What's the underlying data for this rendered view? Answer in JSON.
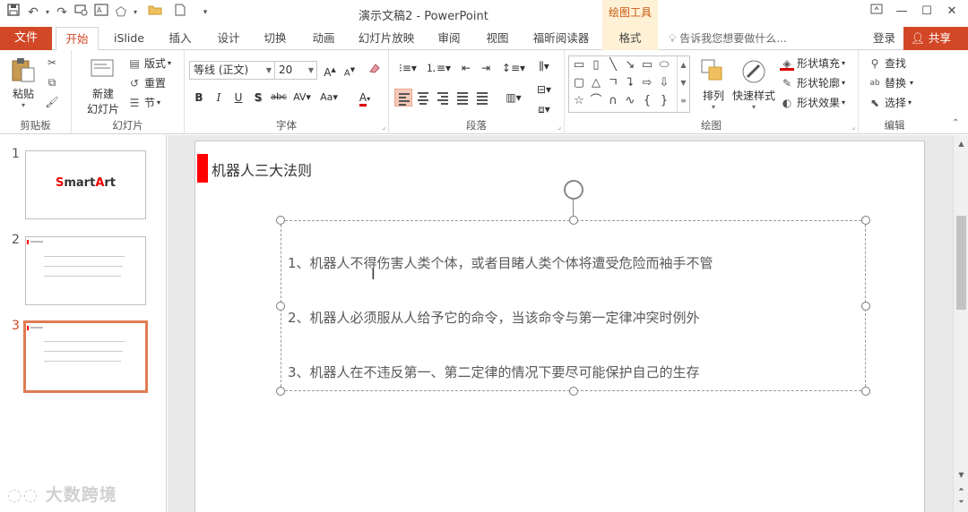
{
  "window": {
    "title": "演示文稿2 - PowerPoint",
    "context_tab": "绘图工具"
  },
  "tabs": {
    "file": "文件",
    "items": [
      "开始",
      "iSlide",
      "插入",
      "设计",
      "切换",
      "动画",
      "幻灯片放映",
      "审阅",
      "视图",
      "福昕阅读器",
      "格式"
    ],
    "active": "开始",
    "tell_me": "告诉我您想要做什么...",
    "login": "登录",
    "share": "共享"
  },
  "ribbon": {
    "clipboard": {
      "label": "剪贴板",
      "paste": "粘贴"
    },
    "slides": {
      "label": "幻灯片",
      "new_slide_line1": "新建",
      "new_slide_line2": "幻灯片",
      "layout": "版式",
      "reset": "重置",
      "section": "节"
    },
    "font": {
      "label": "字体",
      "font_name": "等线 (正文)",
      "font_size": "20"
    },
    "paragraph": {
      "label": "段落"
    },
    "drawing": {
      "label": "绘图",
      "arrange": "排列",
      "quick_styles": "快速样式",
      "shape_fill": "形状填充",
      "shape_outline": "形状轮廓",
      "shape_effects": "形状效果"
    },
    "editing": {
      "label": "编辑",
      "find": "查找",
      "replace": "替换",
      "select": "选择"
    }
  },
  "thumbnails": {
    "numbers": [
      "1",
      "2",
      "3"
    ],
    "slide1_text": "SmartArt",
    "active_index": 3
  },
  "slide": {
    "title": "机器人三大法则",
    "paragraphs": [
      "1、机器人不得伤害人类个体，或者目睹人类个体将遭受危险而袖手不管",
      "2、机器人必须服从人给予它的命令，当该命令与第一定律冲突时例外",
      "3、机器人在不违反第一、第二定律的情况下要尽可能保护自己的生存"
    ]
  },
  "watermark": "大数跨境",
  "colors": {
    "accent": "#d24726",
    "context_tab_bg": "#fff1d6",
    "slide_title_bar": "#ff0000",
    "active_thumb_border": "#e07b53"
  }
}
